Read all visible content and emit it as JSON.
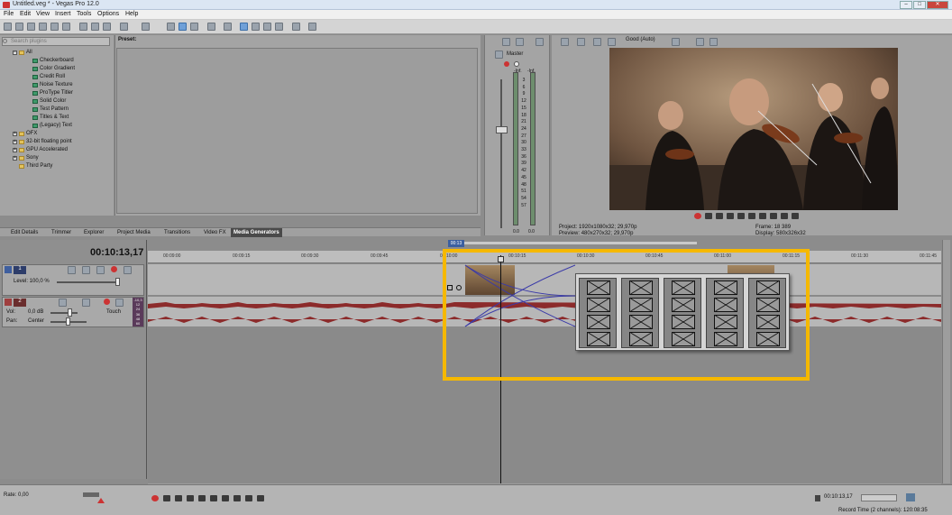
{
  "window": {
    "title": "Untitled.veg * - Vegas Pro 12.0",
    "min": "–",
    "max": "□",
    "close": "✕"
  },
  "menu": [
    "File",
    "Edit",
    "View",
    "Insert",
    "Tools",
    "Options",
    "Help"
  ],
  "generators": {
    "search_placeholder": "Search plugins",
    "tree": [
      {
        "label": "All",
        "type": "folder",
        "expanded": true
      },
      {
        "label": "Checkerboard",
        "type": "gen"
      },
      {
        "label": "Color Gradient",
        "type": "gen"
      },
      {
        "label": "Credit Roll",
        "type": "gen"
      },
      {
        "label": "Noise Texture",
        "type": "gen"
      },
      {
        "label": "ProType Titler",
        "type": "gen"
      },
      {
        "label": "Solid Color",
        "type": "gen"
      },
      {
        "label": "Test Pattern",
        "type": "gen"
      },
      {
        "label": "Titles & Text",
        "type": "gen"
      },
      {
        "label": "(Legacy) Text",
        "type": "gen"
      },
      {
        "label": "OFX",
        "type": "folder"
      },
      {
        "label": "32-bit floating point",
        "type": "folder"
      },
      {
        "label": "GPU Accelerated",
        "type": "folder"
      },
      {
        "label": "Sony",
        "type": "folder"
      },
      {
        "label": "Third Party",
        "type": "folder"
      }
    ],
    "preset_label": "Preset:"
  },
  "tabs": [
    "Edit Details",
    "Trimmer",
    "Explorer",
    "Project Media",
    "Transitions",
    "Video FX",
    "Media Generators"
  ],
  "active_tab": "Media Generators",
  "mixer": {
    "label": "Master",
    "db_scale": [
      "3",
      "6",
      "9",
      "12",
      "15",
      "18",
      "21",
      "24",
      "27",
      "30",
      "33",
      "36",
      "39",
      "42",
      "45",
      "48",
      "51",
      "54",
      "57"
    ],
    "peak_left": "-Inf.",
    "peak_right": "-Inf.",
    "level_left": "0.0",
    "level_right": "0.0"
  },
  "preview": {
    "quality": "Good (Auto)",
    "project_label": "Project:",
    "project_value": "1920x1080x32; 29,970p",
    "preview_label": "Preview:",
    "preview_value": "480x270x32; 29,970p",
    "frame_label": "Frame:",
    "frame_value": "18 389",
    "display_label": "Display:",
    "display_value": "580x326x32"
  },
  "timeline": {
    "timecode": "00:10:13,17",
    "cursor_flag": "00:13",
    "ruler": [
      "00:09:00",
      "00:09:15",
      "00:09:30",
      "00:09:45",
      "00:10:00",
      "00:10:15",
      "00:10:30",
      "00:10:45",
      "00:11:00",
      "00:11:15",
      "00:11:30",
      "00:11:45"
    ],
    "video_track": {
      "number": "1",
      "level": "Level: 100,0 %"
    },
    "audio_track": {
      "number": "2",
      "vol": "Vol:",
      "vol_value": "0,0 dB",
      "pan": "Pan:",
      "pan_value": "Center",
      "mode": "Touch",
      "meter_vals": [
        "-10,3",
        "12",
        "24",
        "36",
        "48",
        "60"
      ]
    }
  },
  "bottom": {
    "rate": "Rate: 0,00",
    "end_time": "00:10:13,17",
    "record_time": "Record Time (2 channels): 120:08:35"
  },
  "colors": {
    "highlight": "#f5b800",
    "waveform": "#8c2b2b",
    "active_tab": "#4a4a4a"
  }
}
